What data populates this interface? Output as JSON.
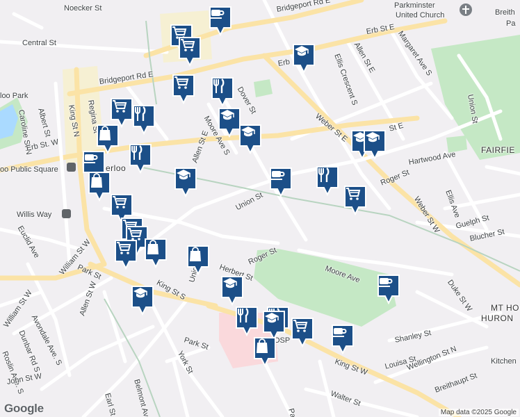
{
  "map": {
    "colors": {
      "background": "#f1eff2",
      "park": "#c5e8c5",
      "road": "#ffffff",
      "arterial": "#fbe3a6",
      "water": "#aadaff",
      "hospital": "#fad9dc",
      "marker": "#1c4f88"
    },
    "labels": {
      "noeckerSt": "Noecker St",
      "bridgeportRdE_top": "Bridgeport Rd E",
      "parkminster": "Parkminster",
      "unitedChurch": "United Church",
      "breith": "Breith",
      "pa": "Pa",
      "centralSt": "Central St",
      "erbStE_top": "Erb St E",
      "erb": "Erb",
      "margaretAve": "Margaret Ave S",
      "allenStE_top": "Allen St E",
      "ellisCrescent": "Ellis Crescent S",
      "bridgeportRdE": "Bridgeport Rd E",
      "ooPark": "loo Park",
      "unionSt_right": "Union St",
      "carolineSt": "Caroline St N",
      "albertSt": "Albert St",
      "reginaSt": "Regina St",
      "kingStN": "King St N",
      "doverSt": "Dover St",
      "weberStE": "Weber St E",
      "mooreAveS": "Moore Ave S",
      "stE": "St E",
      "erbStW": "Erb St. W",
      "erlooPrefix": "erloo",
      "allenStE": "Allen St E",
      "fairfie": "FAIRFIE",
      "publicSquare": "oo Public Square",
      "hartwoodAve": "Hartwood Ave",
      "unionSt": "Union St",
      "rogerSt": "Roger St",
      "ellisAve": "Ellis Ave",
      "willisWay": "Willis Way",
      "weberStW": "Weber St W",
      "guelphSt": "Guelph St",
      "euclidAve": "Euclid Ave",
      "williamStW_diag": "William St W",
      "bluecherSt": "Blucher St",
      "herbertSt": "Herbert St",
      "rogerStS": "Roger St",
      "kingStS": "King St S",
      "parkSt": "Park St",
      "mooreAve": "Moore Ave",
      "dukeStW": "Duke St W",
      "unionStShort": "Union St",
      "allenStW": "Allen St W",
      "mtHo": "MT HO",
      "huron": "HURON",
      "williamStW": "William St W",
      "avondaleAve": "Avondale Ave. S",
      "dunbarRd": "Dunbar Rd S",
      "roslinAve": "Roslin Ave. S",
      "johnStW": "John St W",
      "parkStBottom": "Park St",
      "yorkSt": "York St",
      "shanleySt": "Shanley St",
      "kingStW": "King St W",
      "louisaSt": "Louisa St",
      "wellingtonStN": "Wellington St N",
      "kitchen": "Kitchen",
      "breithauptSt": "Breithaupt St",
      "earlSt": "Earl St",
      "belmontAve": "Belmont Av",
      "walterSt": "Walter St",
      "parStub": "Par",
      "osp": "OSP"
    },
    "markers": [
      {
        "type": "cafe-icon"
      },
      {
        "type": "cart-icon"
      },
      {
        "type": "cart-icon"
      },
      {
        "type": "school-icon"
      },
      {
        "type": "cart-icon"
      },
      {
        "type": "restaurant-icon"
      },
      {
        "type": "cart-icon"
      },
      {
        "type": "restaurant-icon"
      },
      {
        "type": "school-icon"
      },
      {
        "type": "school-icon"
      },
      {
        "type": "bag-icon"
      },
      {
        "type": "restaurant-icon"
      },
      {
        "type": "cafe-icon"
      },
      {
        "type": "bag-icon"
      },
      {
        "type": "school-icon"
      },
      {
        "type": "school-icon"
      },
      {
        "type": "school-icon"
      },
      {
        "type": "cafe-icon"
      },
      {
        "type": "restaurant-icon"
      },
      {
        "type": "cart-icon"
      },
      {
        "type": "cart-icon"
      },
      {
        "type": "cart-icon"
      },
      {
        "type": "cart-icon"
      },
      {
        "type": "cart-icon"
      },
      {
        "type": "bag-icon"
      },
      {
        "type": "bag-icon"
      },
      {
        "type": "school-icon"
      },
      {
        "type": "school-icon"
      },
      {
        "type": "cafe-icon"
      },
      {
        "type": "restaurant-icon"
      },
      {
        "type": "restaurant-icon"
      },
      {
        "type": "school-icon"
      },
      {
        "type": "cart-icon"
      },
      {
        "type": "cafe-icon"
      },
      {
        "type": "bag-icon"
      }
    ],
    "google_logo": "Google",
    "attribution": "Map data ©2025 Google"
  }
}
